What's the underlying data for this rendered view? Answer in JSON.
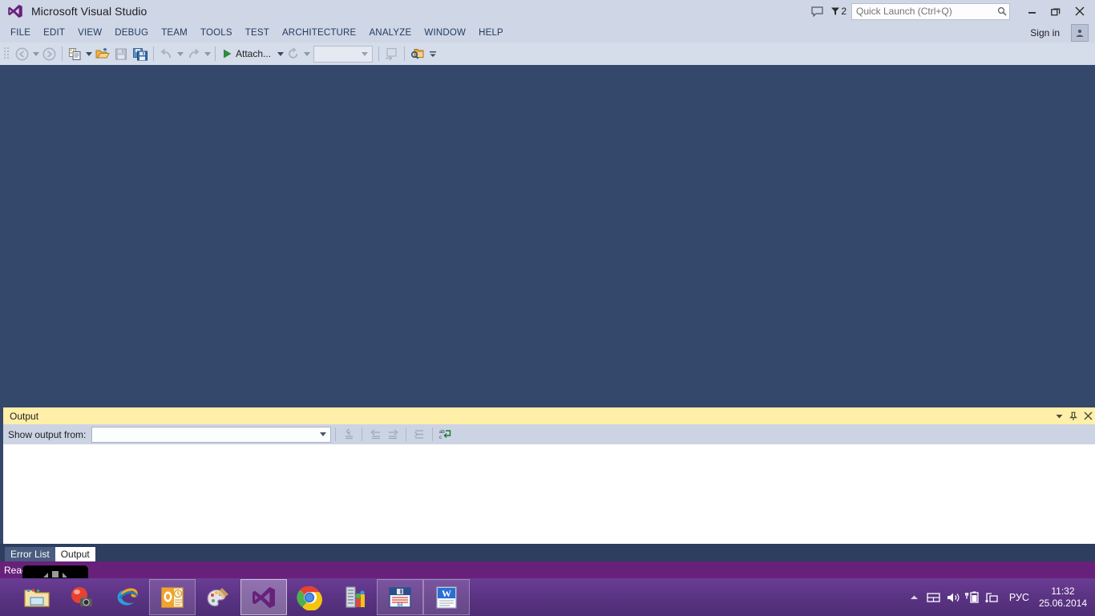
{
  "titlebar": {
    "app_title": "Microsoft Visual Studio",
    "logo_icon": "visual-studio-logo",
    "feedback_icon": "feedback-speech-bubble-icon",
    "notification_icon": "notification-flag-icon",
    "notification_count": "2",
    "quick_launch_placeholder": "Quick Launch (Ctrl+Q)",
    "quick_launch_value": "",
    "search_icon": "magnifier-icon",
    "minimize_icon": "minimize-icon",
    "restore_icon": "restore-icon",
    "close_icon": "close-icon"
  },
  "menubar": {
    "items": [
      {
        "label": "FILE"
      },
      {
        "label": "EDIT"
      },
      {
        "label": "VIEW"
      },
      {
        "label": "DEBUG"
      },
      {
        "label": "TEAM"
      },
      {
        "label": "TOOLS"
      },
      {
        "label": "TEST"
      },
      {
        "label": "ARCHITECTURE"
      },
      {
        "label": "ANALYZE"
      },
      {
        "label": "WINDOW"
      },
      {
        "label": "HELP"
      }
    ],
    "sign_in_label": "Sign in",
    "account_icon": "user-account-icon"
  },
  "toolbar": {
    "grip_icon": "drag-grip-icon",
    "nav_back_icon": "navigate-back-icon",
    "nav_back_caret_icon": "chevron-down-icon",
    "nav_forward_icon": "navigate-forward-icon",
    "new_item_icon": "new-item-icon",
    "new_item_caret_icon": "chevron-down-icon",
    "open_file_icon": "open-folder-icon",
    "save_icon": "save-icon",
    "save_all_icon": "save-all-icon",
    "undo_icon": "undo-icon",
    "undo_caret_icon": "chevron-down-icon",
    "redo_icon": "redo-icon",
    "redo_caret_icon": "chevron-down-icon",
    "attach_icon": "play-triangle-icon",
    "attach_label": "Attach...",
    "attach_caret_icon": "chevron-down-icon",
    "restart_icon": "restart-circular-arrow-icon",
    "restart_caret_icon": "chevron-down-icon",
    "config_combo_value": "",
    "config_combo_caret_icon": "chevron-down-icon",
    "step_icon": "step-into-icon",
    "find_icon": "find-in-window-icon",
    "overflow_icon": "toolbar-overflow-icon"
  },
  "output_panel": {
    "title": "Output",
    "window_caret_icon": "chevron-down-icon",
    "pin_icon": "pin-icon",
    "close_icon": "close-icon",
    "show_output_from_label": "Show output from:",
    "source_combo_value": "",
    "source_combo_caret_icon": "chevron-down-icon",
    "buttons": [
      {
        "icon": "go-to-message-icon"
      },
      {
        "icon": "previous-message-icon"
      },
      {
        "icon": "next-message-icon"
      },
      {
        "icon": "clear-all-icon"
      },
      {
        "icon": "word-wrap-icon"
      }
    ],
    "content": ""
  },
  "tabstrip": {
    "tabs": [
      {
        "label": "Error List",
        "active": false
      },
      {
        "label": "Output",
        "active": true
      }
    ]
  },
  "statusbar": {
    "text": "Ready",
    "osd_icon": "volume-osd-overlay"
  },
  "taskbar": {
    "items": [
      {
        "icon": "file-explorer-icon",
        "state": "plain"
      },
      {
        "icon": "camera-recorder-icon",
        "state": "plain"
      },
      {
        "icon": "internet-explorer-icon",
        "state": "plain"
      },
      {
        "icon": "outlook-icon",
        "state": "framed"
      },
      {
        "icon": "paint-icon",
        "state": "plain"
      },
      {
        "icon": "visual-studio-icon",
        "state": "running"
      },
      {
        "icon": "google-chrome-icon",
        "state": "plain"
      },
      {
        "icon": "server-tools-icon",
        "state": "plain"
      },
      {
        "icon": "floppy-save-icon",
        "state": "framed"
      },
      {
        "icon": "microsoft-word-icon",
        "state": "framed"
      }
    ],
    "tray": {
      "show_hidden_icon": "show-hidden-icons-arrow",
      "icons": [
        {
          "icon": "action-center-icon"
        },
        {
          "icon": "volume-icon"
        },
        {
          "icon": "battery-power-icon"
        },
        {
          "icon": "network-icon"
        }
      ],
      "language": "РУС",
      "time": "11:32",
      "date": "25.06.2014"
    }
  },
  "colors": {
    "title_bar": "#cfd6e6",
    "toolbar": "#d5dcea",
    "workspace": "#34486b",
    "panel_header": "#ffefa8",
    "status_bar": "#68217a",
    "taskbar": "#5a3383",
    "vs_purple": "#68217a"
  }
}
